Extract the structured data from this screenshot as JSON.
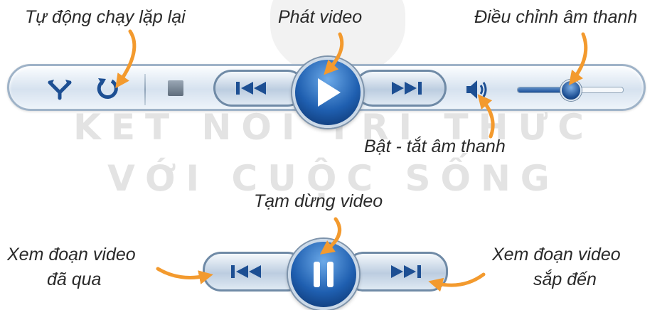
{
  "watermark": {
    "line1": "KẾT NỐI TRI THỨC",
    "line2": "VỚI CUỘC SỐNG"
  },
  "labels": {
    "repeat": "Tự động chạy lặp lại",
    "play": "Phát video",
    "volume_adjust": "Điều chỉnh âm thanh",
    "mute": "Bật - tắt âm thanh",
    "pause": "Tạm dừng video",
    "previous_line1": "Xem đoạn video",
    "previous_line2": "đã qua",
    "next_line1": "Xem đoạn video",
    "next_line2": "sắp đến"
  },
  "player": {
    "icons": [
      "shuffle-icon",
      "repeat-icon",
      "stop-icon",
      "previous-icon",
      "play-icon",
      "next-icon",
      "speaker-icon"
    ],
    "volume_level": 0.5
  },
  "colors": {
    "arrow": "#f39a2e",
    "button_blue": "#1f5fb0",
    "bar_border": "#9fb3c8"
  }
}
